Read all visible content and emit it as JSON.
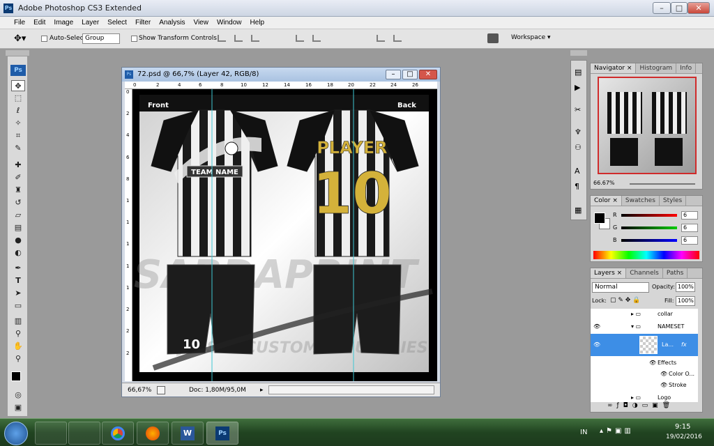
{
  "app": {
    "title": "Adobe Photoshop CS3 Extended",
    "ps_badge": "Ps"
  },
  "window_controls": {
    "minimize": "–",
    "maximize": "□",
    "close": "✕"
  },
  "menu": [
    "File",
    "Edit",
    "Image",
    "Layer",
    "Select",
    "Filter",
    "Analysis",
    "View",
    "Window",
    "Help"
  ],
  "options": {
    "auto_select_label": "Auto-Select:",
    "auto_select_value": "Group",
    "show_transform_label": "Show Transform Controls",
    "workspace_label": "Workspace ▾"
  },
  "document": {
    "title": "72.psd @ 66,7% (Layer 42, RGB/8)",
    "zoom": "66,67%",
    "doc_info": "Doc: 1,80M/95,0M",
    "ruler_h": [
      "0",
      "2",
      "4",
      "6",
      "8",
      "10",
      "12",
      "14",
      "16",
      "18",
      "20",
      "22",
      "24",
      "26"
    ],
    "ruler_v": [
      "0",
      "2",
      "4",
      "6",
      "8",
      "1",
      "1",
      "1",
      "1",
      "1",
      "2",
      "2",
      "2"
    ],
    "front_label": "Front",
    "back_label": "Back",
    "team_name": "TEAM NAME",
    "player": "PLAYER",
    "number": "10",
    "shorts_number": "10",
    "watermark_brand": "SABDAPRINT",
    "watermark_tagline": "JERSEY CUSTOM INDUSTRIES"
  },
  "navigator": {
    "tabs": [
      "Navigator ×",
      "Histogram",
      "Info"
    ],
    "zoom": "66.67%"
  },
  "color": {
    "tabs": [
      "Color ×",
      "Swatches",
      "Styles"
    ],
    "channels": [
      {
        "label": "R",
        "value": "6"
      },
      {
        "label": "G",
        "value": "6"
      },
      {
        "label": "B",
        "value": "6"
      }
    ]
  },
  "layers": {
    "tabs": [
      "Layers ×",
      "Channels",
      "Paths"
    ],
    "blend": "Normal",
    "opacity_label": "Opacity:",
    "opacity": "100%",
    "lock_label": "Lock:",
    "fill_label": "Fill:",
    "fill": "100%",
    "rows": [
      {
        "name": "collar"
      },
      {
        "name": "NAMESET"
      },
      {
        "name": "La..."
      },
      {
        "name": "Effects"
      },
      {
        "name": "Color O..."
      },
      {
        "name": "Stroke"
      },
      {
        "name": "Logo"
      }
    ]
  },
  "taskbar": {
    "lang": "IN",
    "time": "9:15",
    "date": "19/02/2016"
  }
}
